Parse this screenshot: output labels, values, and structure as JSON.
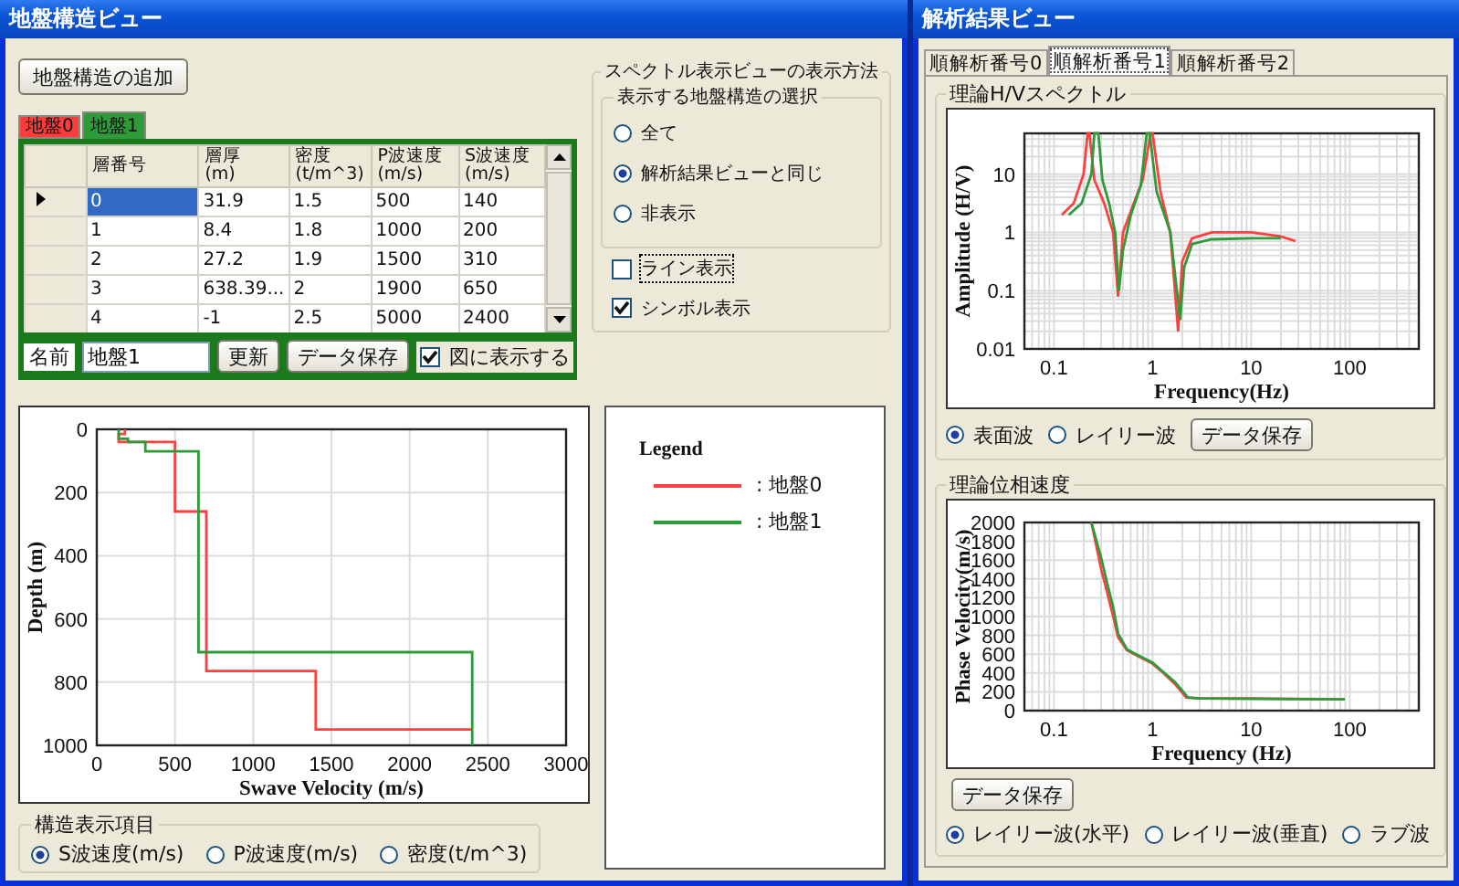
{
  "left_window": {
    "title": "地盤構造ビュー",
    "add_button": "地盤構造の追加",
    "ground_tabs": [
      {
        "label": "地盤0",
        "color": "#ff3b3b",
        "selected": false
      },
      {
        "label": "地盤1",
        "color": "#2f9a3a",
        "selected": true
      }
    ],
    "layer_table": {
      "columns": [
        "層番号",
        "層厚\n(m)",
        "密度\n(t/m^3)",
        "P波速度\n(m/s)",
        "S波速度\n(m/s)"
      ],
      "rows": [
        {
          "cells": [
            "0",
            "31.9",
            "1.5",
            "500",
            "140"
          ],
          "selected": true
        },
        {
          "cells": [
            "1",
            "8.4",
            "1.8",
            "1000",
            "200"
          ],
          "selected": false
        },
        {
          "cells": [
            "2",
            "27.2",
            "1.9",
            "1500",
            "310"
          ],
          "selected": false
        },
        {
          "cells": [
            "3",
            "638.39...",
            "2",
            "1900",
            "650"
          ],
          "selected": false
        },
        {
          "cells": [
            "4",
            "-1",
            "2.5",
            "5000",
            "2400"
          ],
          "selected": false
        }
      ]
    },
    "name_label": "名前",
    "name_field": {
      "value": "地盤1"
    },
    "update_button": "更新",
    "save_button": "データ保存",
    "show_in_figure": {
      "label": "図に表示する",
      "checked": true
    },
    "display_settings": {
      "title": "スペクトル表示ビューの表示方法",
      "selection_group": {
        "title": "表示する地盤構造の選択",
        "options": [
          {
            "label": "全て",
            "selected": false
          },
          {
            "label": "解析結果ビューと同じ",
            "selected": true
          },
          {
            "label": "非表示",
            "selected": false
          }
        ]
      },
      "checkboxes": [
        {
          "label": "ライン表示",
          "checked": false,
          "focused": true
        },
        {
          "label": "シンボル表示",
          "checked": true,
          "focused": false
        }
      ]
    },
    "profile_chart": {
      "chart_data": {
        "type": "line",
        "grid": true,
        "xlabel": "Swave Velocity (m/s)",
        "ylabel": "Depth (m)",
        "xlim": [
          0,
          3000
        ],
        "ylim": [
          1000,
          0
        ],
        "xticks": [
          0,
          500,
          1000,
          1500,
          2000,
          2500,
          3000
        ],
        "yticks": [
          0,
          200,
          400,
          600,
          800,
          1000
        ],
        "series": [
          {
            "color": "#ff4040",
            "x": [
              180,
              180,
              140,
              140,
              500,
              500,
              700,
              700,
              1400,
              1400,
              2400
            ],
            "values": [
              0,
              15,
              15,
              40,
              40,
              260,
              260,
              765,
              765,
              950,
              950
            ]
          },
          {
            "color": "#2f9a3a",
            "x": [
              140,
              140,
              200,
              200,
              310,
              310,
              650,
              650,
              2400,
              2400
            ],
            "values": [
              0,
              30,
              30,
              40,
              40,
              70,
              70,
              705,
              705,
              1000
            ]
          }
        ]
      }
    },
    "legend": {
      "title": "Legend",
      "items": [
        {
          "label": ": 地盤0",
          "color": "#ff4040"
        },
        {
          "label": ": 地盤1",
          "color": "#2f9a3a"
        }
      ]
    },
    "structure_items": {
      "title": "構造表示項目",
      "options": [
        {
          "label": "S波速度(m/s)",
          "selected": true
        },
        {
          "label": "P波速度(m/s)",
          "selected": false
        },
        {
          "label": "密度(t/m^3)",
          "selected": false
        }
      ]
    }
  },
  "right_window": {
    "title": "解析結果ビュー",
    "tabs": [
      {
        "label": "順解析番号0",
        "selected": false
      },
      {
        "label": "順解析番号1",
        "selected": true
      },
      {
        "label": "順解析番号2",
        "selected": false
      }
    ],
    "hv_spectrum": {
      "title": "理論H/Vスペクトル",
      "plot": {
        "xlabel": "Frequency(Hz)",
        "ylabel": "Amplitude (H/V)",
        "x_tick_labels": [
          "0.1",
          "1",
          "10",
          "100"
        ],
        "y_tick_labels": [
          "10",
          "1",
          "0.1",
          "0.01"
        ]
      },
      "modes": [
        {
          "label": "表面波",
          "selected": true
        },
        {
          "label": "レイリー波",
          "selected": false
        }
      ],
      "save_button": "データ保存"
    },
    "phase_velocity": {
      "title": "理論位相速度",
      "plot": {
        "xlabel": "Frequency (Hz)",
        "ylabel": "Phase Velocity(m/s)",
        "x_tick_labels": [
          "0.1",
          "1",
          "10",
          "100"
        ],
        "y_tick_labels": [
          "2000",
          "1800",
          "1600",
          "1400",
          "1200",
          "1000",
          "800",
          "600",
          "400",
          "200",
          "0"
        ]
      },
      "save_button": "データ保存",
      "modes": [
        {
          "label": "レイリー波(水平)",
          "selected": true
        },
        {
          "label": "レイリー波(垂直)",
          "selected": false
        },
        {
          "label": "ラブ波",
          "selected": false
        }
      ]
    }
  }
}
